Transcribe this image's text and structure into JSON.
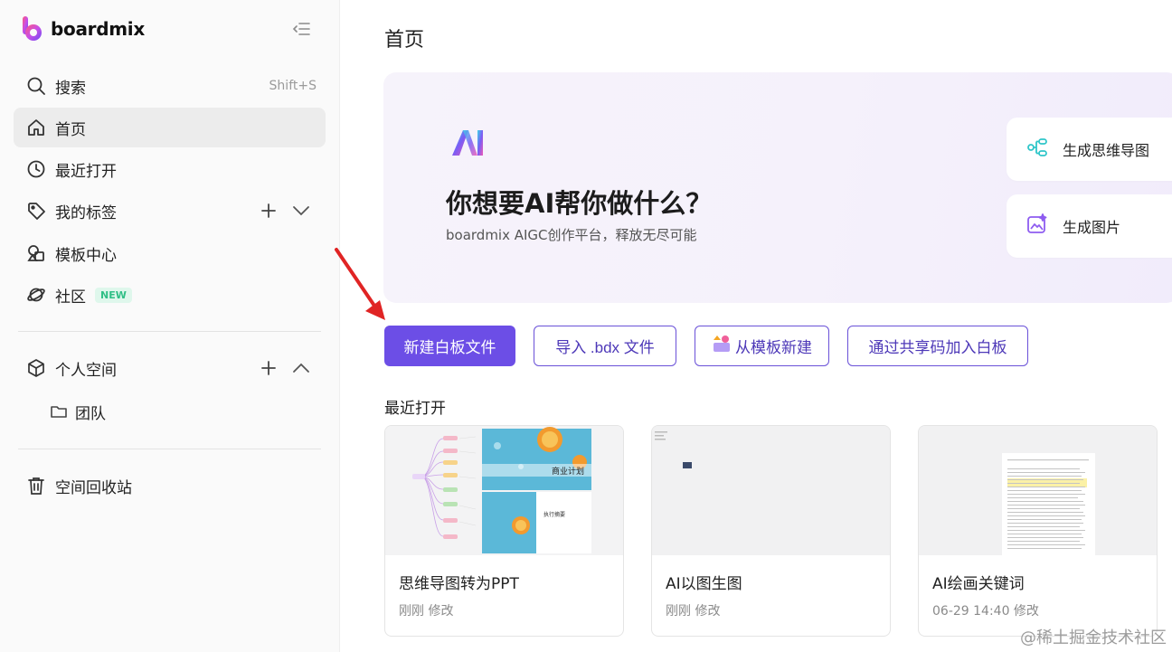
{
  "app": {
    "name": "boardmix"
  },
  "sidebar": {
    "search": {
      "label": "搜索",
      "shortcut": "Shift+S"
    },
    "items": [
      {
        "label": "首页"
      },
      {
        "label": "最近打开"
      },
      {
        "label": "我的标签"
      },
      {
        "label": "模板中心"
      },
      {
        "label": "社区",
        "badge": "NEW"
      }
    ],
    "personal_space": {
      "label": "个人空间"
    },
    "team": {
      "label": "团队"
    },
    "trash": {
      "label": "空间回收站"
    }
  },
  "main": {
    "title": "首页",
    "hero": {
      "title": "你想要AI帮你做什么？",
      "subtitle": "boardmix AIGC创作平台，释放无尽可能",
      "cards": [
        {
          "label": "生成思维导图",
          "icon": "mindmap-icon"
        },
        {
          "label": "生成图片",
          "icon": "image-ai-icon"
        }
      ]
    },
    "actions": {
      "new_board": "新建白板文件",
      "import_bdx": "导入 .bdx 文件",
      "from_template": "从模板新建",
      "join_by_code": "通过共享码加入白板"
    },
    "recent": {
      "title": "最近打开",
      "files": [
        {
          "name": "思维导图转为PPT",
          "meta": "刚刚 修改",
          "thumb_labels": [
            "商业计划",
            "执行摘要"
          ]
        },
        {
          "name": "AI以图生图",
          "meta": "刚刚 修改"
        },
        {
          "name": "AI绘画关键词",
          "meta": "06-29 14:40 修改"
        }
      ]
    }
  },
  "watermark": "@稀土掘金技术社区",
  "colors": {
    "accent": "#6c4ee6",
    "badge_green": "#2fbf86",
    "arrow_red": "#e02424"
  }
}
